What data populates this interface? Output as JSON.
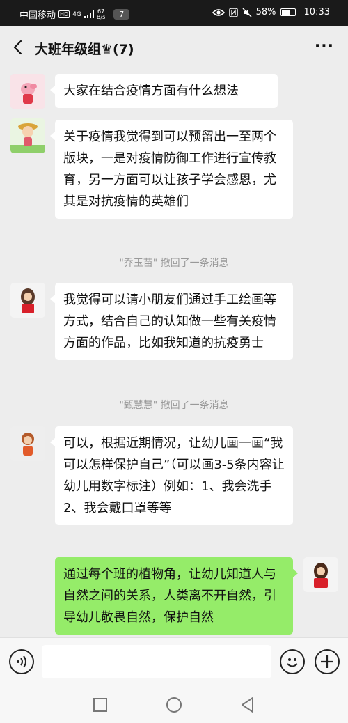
{
  "status_bar": {
    "carrier": "中国移动",
    "hd": "HD",
    "signal": "4G",
    "net_speed_value": "67",
    "net_speed_unit": "B/s",
    "notif_count": "7",
    "battery": "58%",
    "time": "10:33"
  },
  "header": {
    "title": "大班年级组♛(7)",
    "more": "···"
  },
  "messages": [
    {
      "text": "大家在结合疫情方面有什么想法"
    },
    {
      "text": "关于疫情我觉得到可以预留出一至两个版块，一是对疫情防御工作进行宣传教育，另一方面可以让孩子学会感恩，尤其是对抗疫情的英雄们"
    },
    {
      "text": "我觉得可以请小朋友们通过手工绘画等方式，结合自己的认知做一些有关疫情方面的作品，比如我知道的抗疫勇士"
    },
    {
      "text": "可以，根据近期情况，让幼儿画一画“我可以怎样保护自己”（可以画3-5条内容让幼儿用数字标注）例如：1、我会洗手 2、我会戴口罩等等"
    },
    {
      "text": "通过每个班的植物角，让幼儿知道人与自然之间的关系，人类离不开自然，引导幼儿敬畏自然，保护自然"
    }
  ],
  "recalls": [
    {
      "text": "\"乔玉苗\" 撤回了一条消息"
    },
    {
      "text": "\"甄慧慧\" 撤回了一条消息"
    }
  ],
  "colors": {
    "my_bubble": "#95ec69",
    "other_bubble": "#ffffff",
    "background": "#ededed"
  },
  "icons": {
    "voice": "voice-icon",
    "emoji": "emoji-icon",
    "plus": "plus-icon",
    "back": "back-icon",
    "nav_recent": "square-icon",
    "nav_home": "circle-icon",
    "nav_back": "triangle-icon"
  }
}
